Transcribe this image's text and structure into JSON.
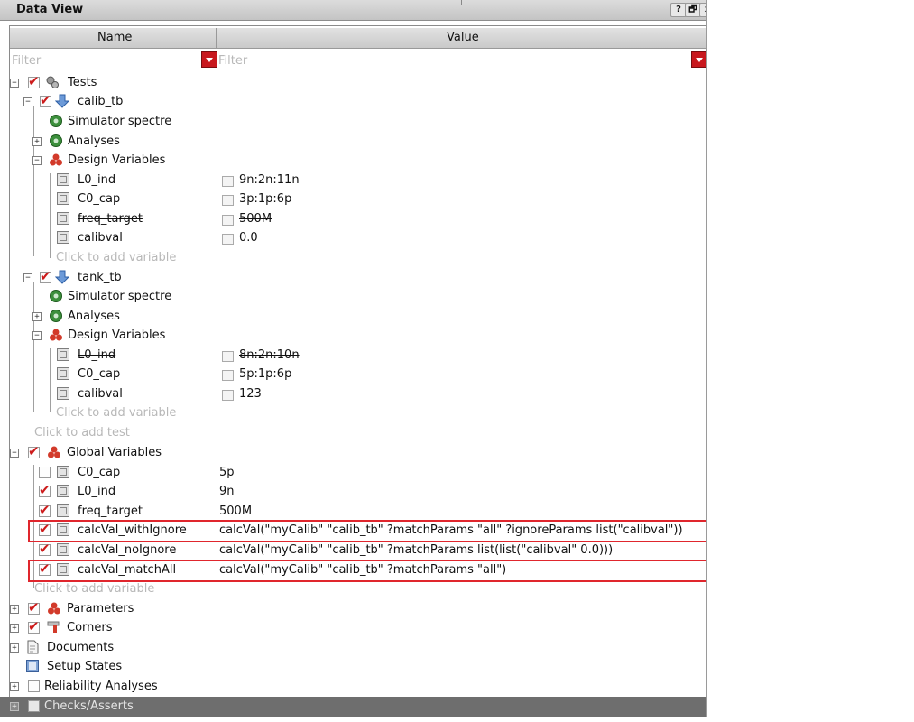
{
  "panel": {
    "title": "Data View",
    "help_label": "?",
    "float_label": "🗗",
    "close_label": "x"
  },
  "columns": {
    "name": "Name",
    "value": "Value"
  },
  "filters": {
    "name_placeholder": "Filter",
    "value_placeholder": "Filter"
  },
  "tree": {
    "tests": {
      "label": "Tests"
    },
    "calib_tb": {
      "label": "calib_tb",
      "simulator": "Simulator  spectre",
      "analyses": "Analyses",
      "design_vars": "Design Variables",
      "vars": [
        {
          "name": "L0_ind",
          "value": "9n:2n:11n"
        },
        {
          "name": "C0_cap",
          "value": "3p:1p:6p"
        },
        {
          "name": "freq_target",
          "value": "500M"
        },
        {
          "name": "calibval",
          "value": "0.0"
        }
      ],
      "add_var": "Click to add variable"
    },
    "tank_tb": {
      "label": "tank_tb",
      "simulator": "Simulator  spectre",
      "analyses": "Analyses",
      "design_vars": "Design Variables",
      "vars": [
        {
          "name": "L0_ind",
          "value": "8n:2n:10n"
        },
        {
          "name": "C0_cap",
          "value": "5p:1p:6p"
        },
        {
          "name": "calibval",
          "value": "123"
        }
      ],
      "add_var": "Click to add variable"
    },
    "add_test": "Click to add test",
    "global": {
      "label": "Global Variables",
      "vars": [
        {
          "name": "C0_cap",
          "value": "5p"
        },
        {
          "name": "L0_ind",
          "value": "9n"
        },
        {
          "name": "freq_target",
          "value": "500M"
        },
        {
          "name": "calcVal_withIgnore",
          "value": "calcVal(\"myCalib\" \"calib_tb\" ?matchParams \"all\" ?ignoreParams list(\"calibval\"))"
        },
        {
          "name": "calcVal_noIgnore",
          "value": "calcVal(\"myCalib\" \"calib_tb\" ?matchParams list(list(\"calibval\" 0.0)))"
        },
        {
          "name": "calcVal_matchAll",
          "value": "calcVal(\"myCalib\" \"calib_tb\" ?matchParams \"all\")"
        }
      ],
      "add_var": "Click to add variable"
    },
    "parameters": "Parameters",
    "corners": "Corners",
    "documents": "Documents",
    "setup_states": "Setup States",
    "reliability": "Reliability Analyses",
    "checks": "Checks/Asserts"
  },
  "colors": {
    "accent_red": "#cc1a1a",
    "highlight_border": "#e0262d",
    "bottom_bar": "#6e6e6e"
  }
}
